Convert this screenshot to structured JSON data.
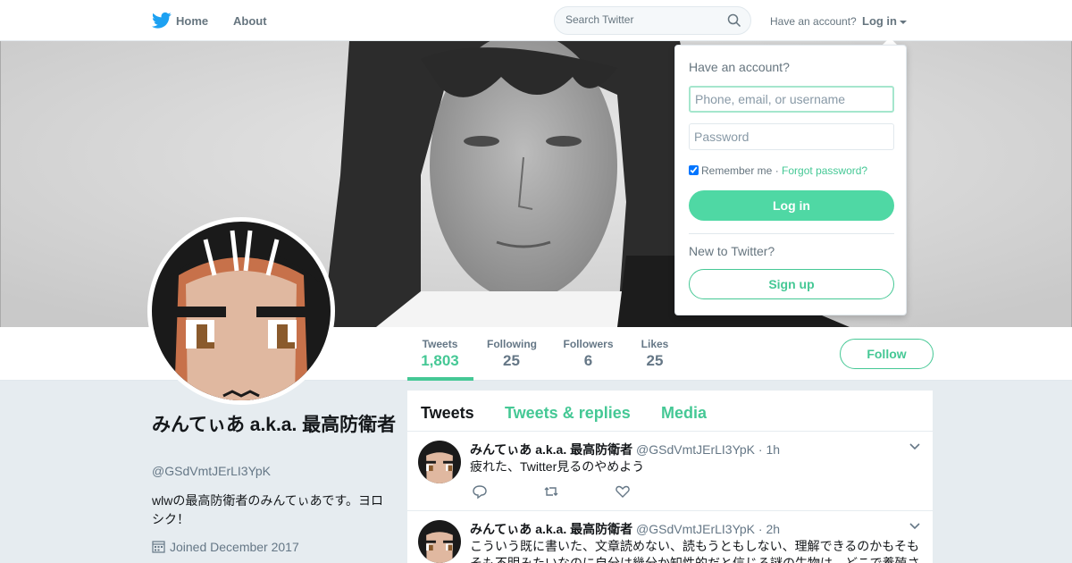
{
  "nav": {
    "logo_icon": "twitter-bird-icon",
    "home_label": "Home",
    "about_label": "About",
    "search_placeholder": "Search Twitter",
    "have_account_text": "Have an account?",
    "login_label": "Log in"
  },
  "colors": {
    "accent": "#45c895",
    "accent_button": "#4fd8a4",
    "twitter_blue": "#1da1f2",
    "background": "#e6ecf0",
    "muted_text": "#657786"
  },
  "login_dropdown": {
    "title": "Have an account?",
    "username_placeholder": "Phone, email, or username",
    "password_placeholder": "Password",
    "remember_label": "Remember me",
    "separator": "·",
    "forgot_label": "Forgot password?",
    "remember_checked": true,
    "login_button": "Log in",
    "new_text": "New to Twitter?",
    "signup_button": "Sign up"
  },
  "profile_nav": {
    "stats": [
      {
        "label": "Tweets",
        "value": "1,803",
        "active": true
      },
      {
        "label": "Following",
        "value": "25",
        "active": false
      },
      {
        "label": "Followers",
        "value": "6",
        "active": false
      },
      {
        "label": "Likes",
        "value": "25",
        "active": false
      }
    ],
    "follow_button": "Follow"
  },
  "profile": {
    "name": "みんてぃあ a.k.a. 最高防衛者",
    "handle": "@GSdVmtJErLI3YpK",
    "bio": "wlwの最高防衛者のみんてぃあです。ヨロシク！",
    "joined": "Joined December 2017",
    "joined_icon": "calendar-icon"
  },
  "timeline": {
    "tabs": [
      {
        "label": "Tweets",
        "active": true
      },
      {
        "label": "Tweets & replies",
        "active": false
      },
      {
        "label": "Media",
        "active": false
      }
    ],
    "tweets": [
      {
        "name": "みんてぃあ a.k.a. 最高防衛者",
        "handle": "@GSdVmtJErLI3YpK",
        "dot": "·",
        "time": "1h",
        "text": "疲れた、Twitter見るのやめよう"
      },
      {
        "name": "みんてぃあ a.k.a. 最高防衛者",
        "handle": "@GSdVmtJErLI3YpK",
        "dot": "·",
        "time": "2h",
        "text": "こういう既に書いた、文章読めない、読もうともしない、理解できるのかもそもそも不明みたいなのに自分は幾分か知性的だと信じる謎の生物は、どこで養殖され"
      }
    ],
    "action_icons": [
      "reply-icon",
      "retweet-icon",
      "like-icon"
    ]
  }
}
